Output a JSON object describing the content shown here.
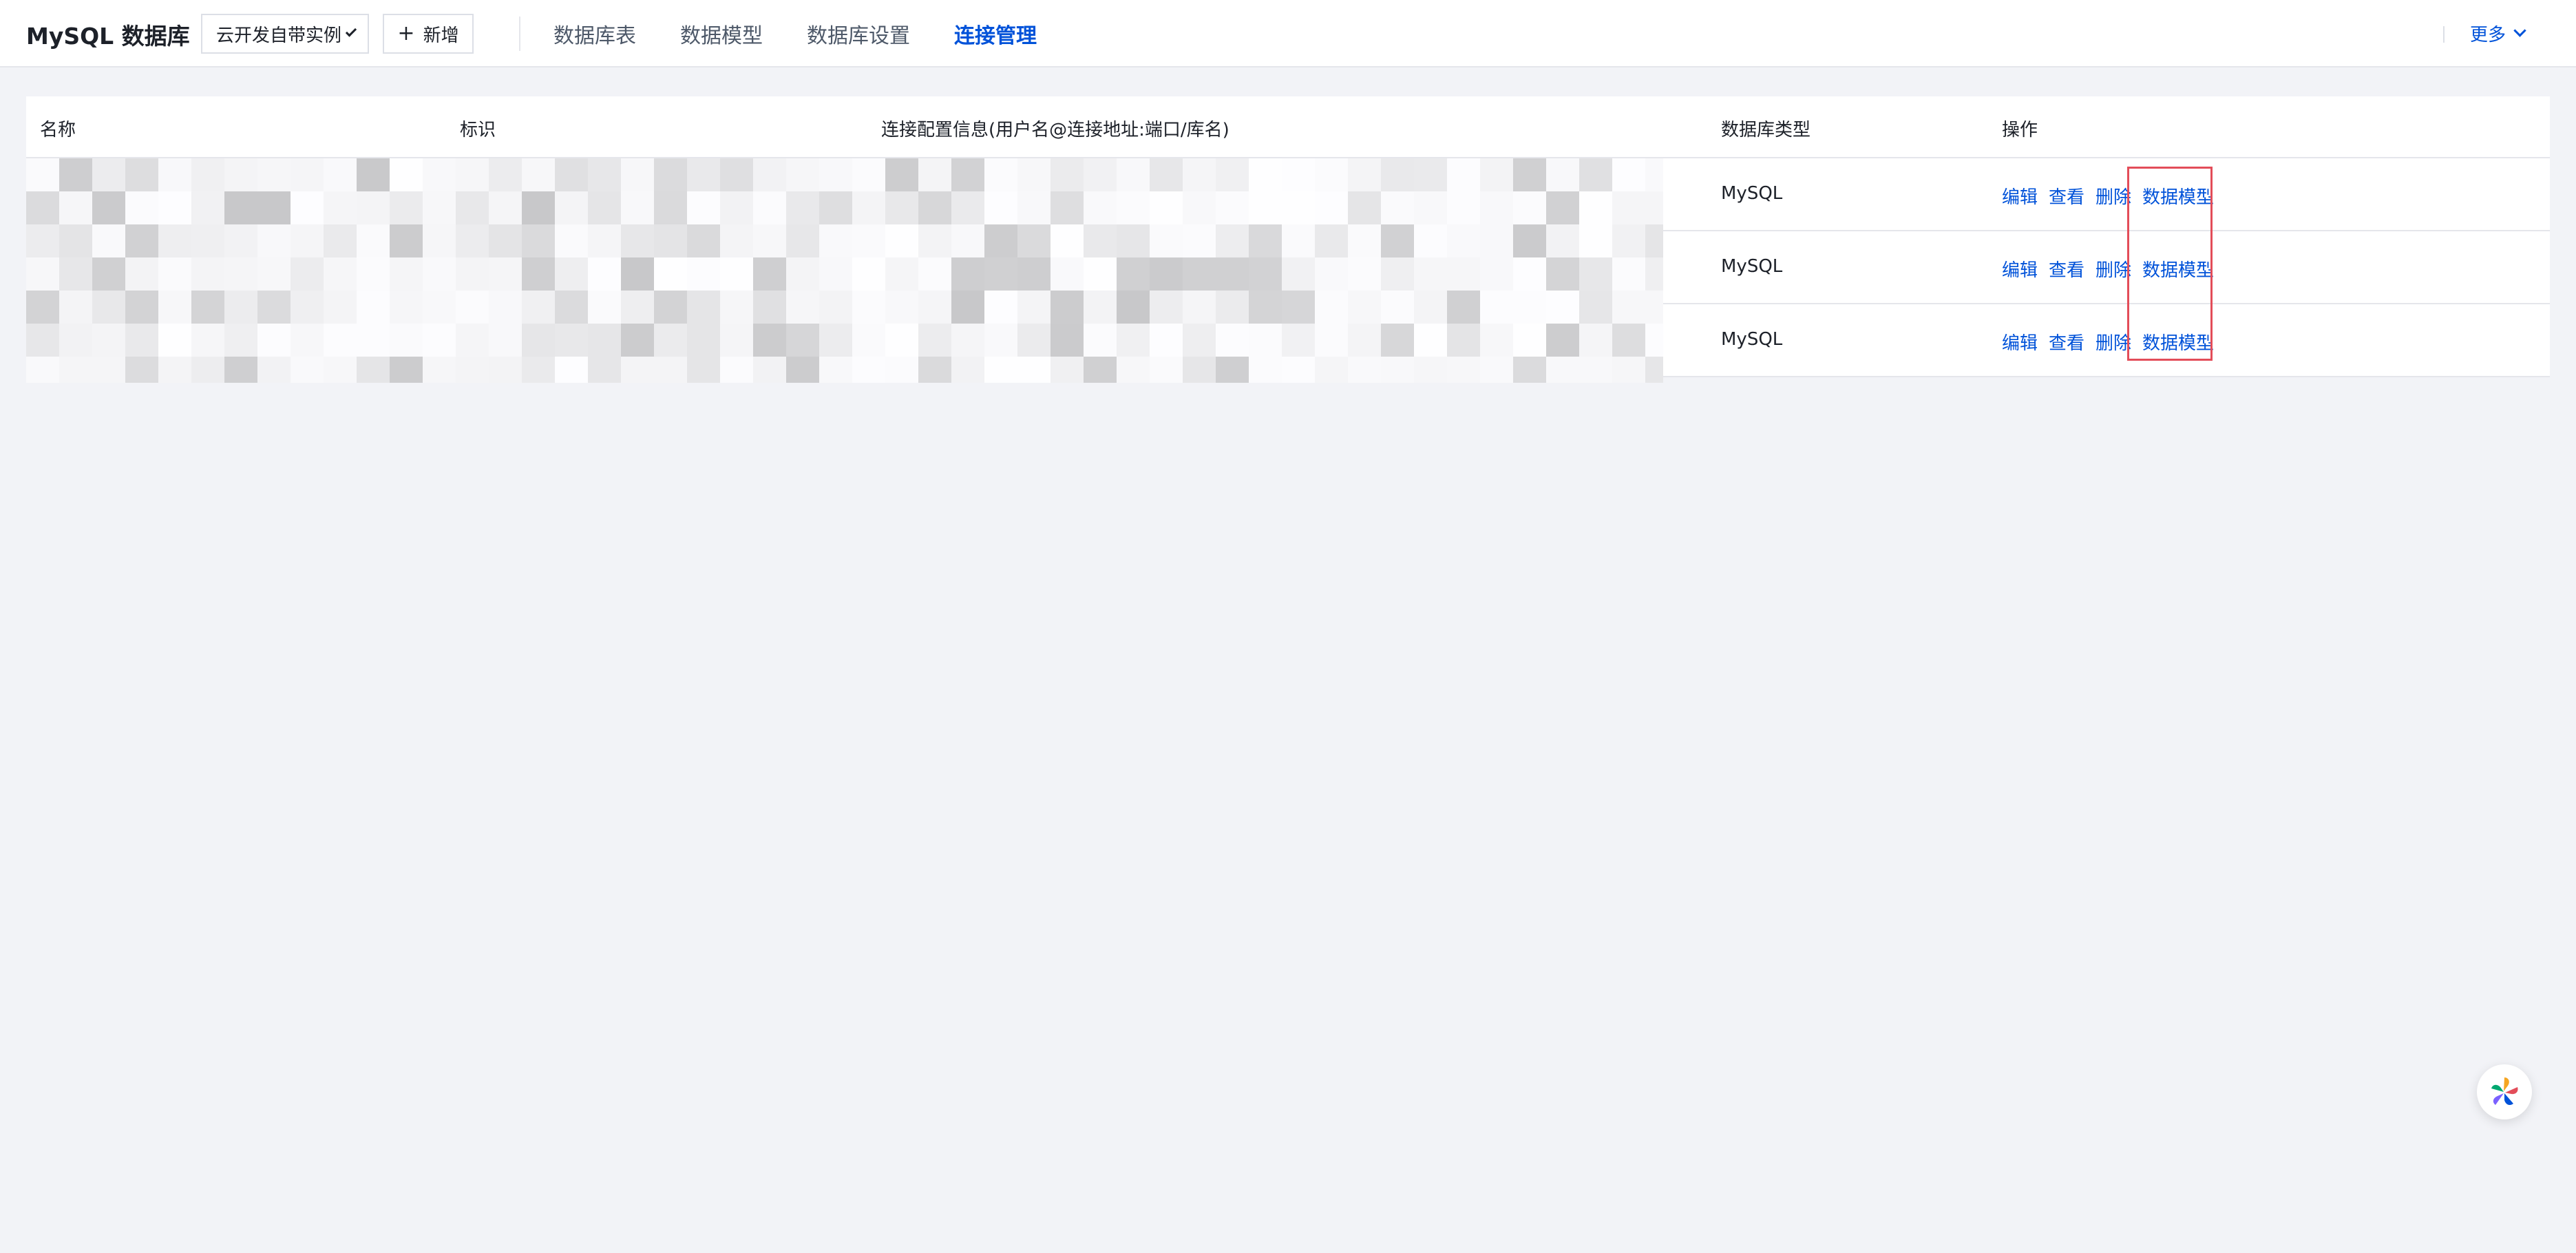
{
  "header": {
    "app_title": "MySQL 数据库",
    "instance_select": "云开发自带实例",
    "add_label": "新增",
    "nav": [
      {
        "label": "数据库表",
        "active": false
      },
      {
        "label": "数据模型",
        "active": false
      },
      {
        "label": "数据库设置",
        "active": false
      },
      {
        "label": "连接管理",
        "active": true
      }
    ],
    "more_label": "更多"
  },
  "table": {
    "columns": {
      "name": "名称",
      "identifier": "标识",
      "connection_info": "连接配置信息(用户名@连接地址:端口/库名)",
      "db_type": "数据库类型",
      "actions": "操作"
    },
    "rows": [
      {
        "db_type": "MySQL",
        "actions": [
          "编辑",
          "查看",
          "删除",
          "数据模型"
        ]
      },
      {
        "db_type": "MySQL",
        "actions": [
          "编辑",
          "查看",
          "删除",
          "数据模型"
        ]
      },
      {
        "db_type": "MySQL",
        "actions": [
          "编辑",
          "查看",
          "删除",
          "数据模型"
        ]
      }
    ]
  },
  "colors": {
    "accent": "#0052d9",
    "highlight": "#e34d59",
    "background": "#f2f3f7"
  }
}
